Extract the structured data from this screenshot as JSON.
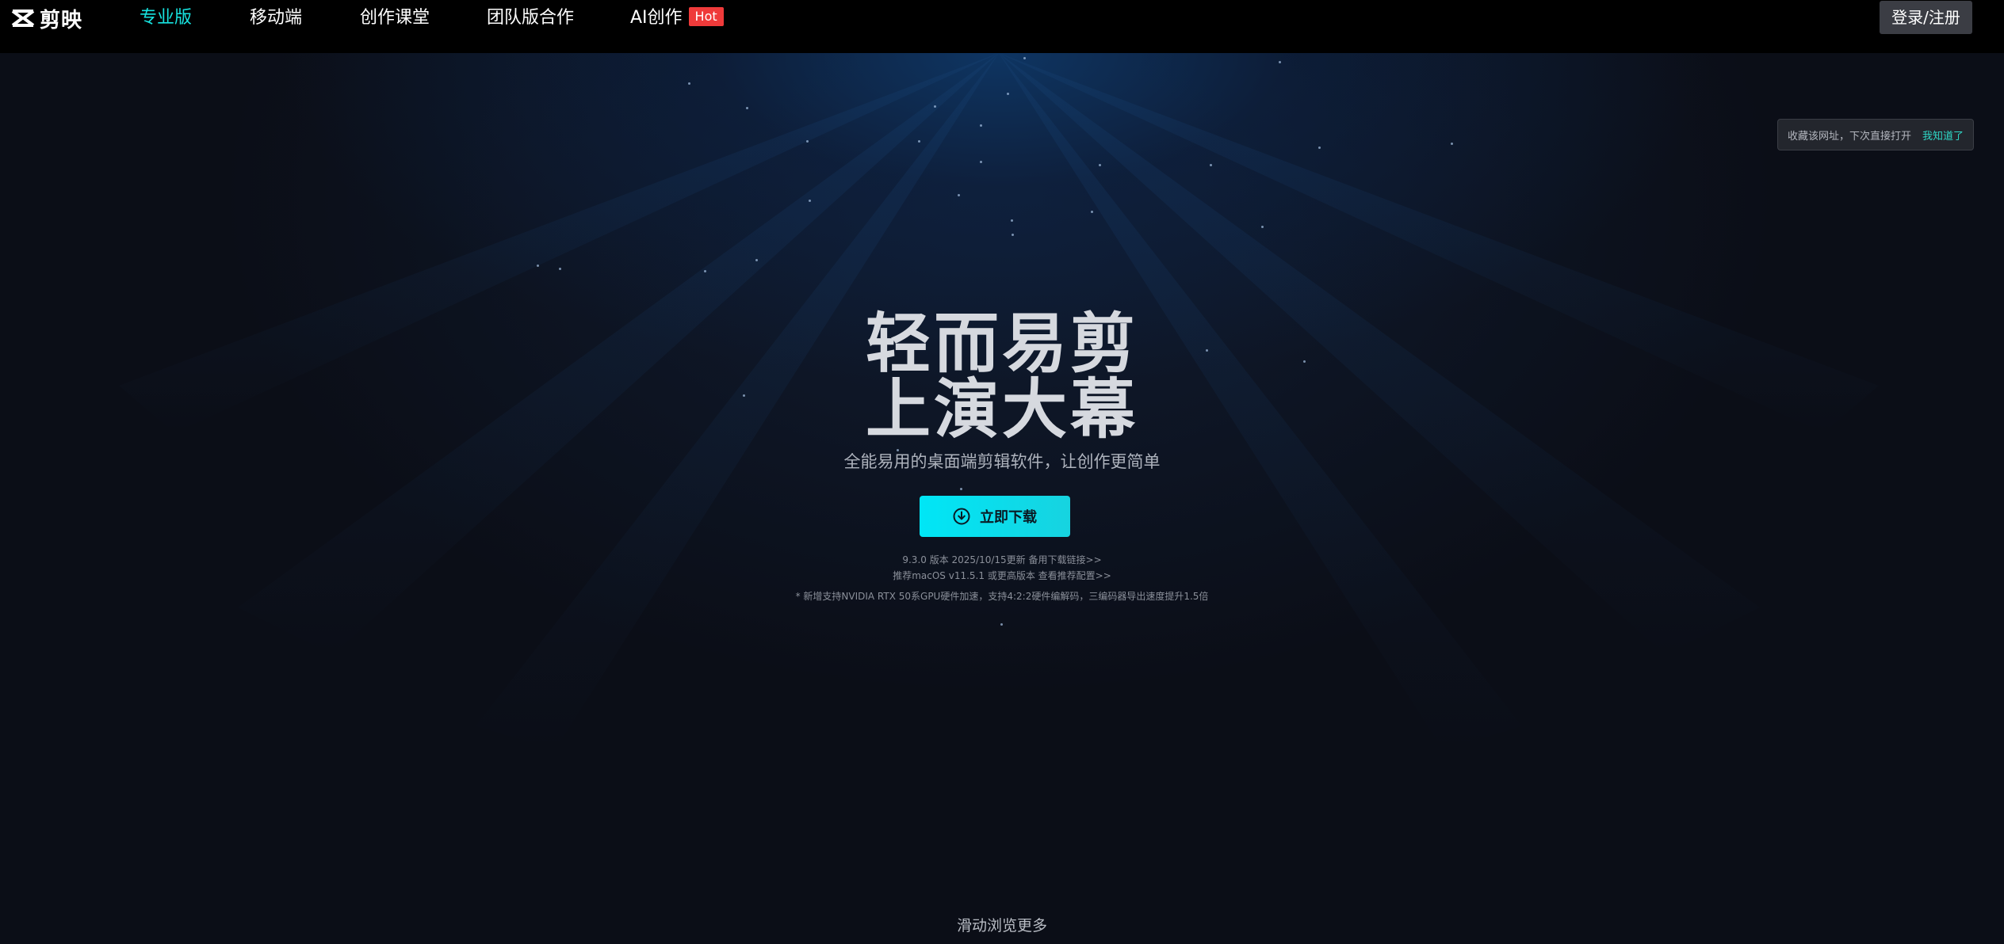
{
  "nav": {
    "logo_text": "剪映",
    "items": [
      {
        "label": "专业版"
      },
      {
        "label": "移动端"
      },
      {
        "label": "创作课堂"
      },
      {
        "label": "团队版合作"
      },
      {
        "label": "AI创作"
      }
    ],
    "hot_badge": "Hot",
    "login_label": "登录/注册"
  },
  "tooltip": {
    "text": "收藏该网址，下次直接打开",
    "button": "我知道了"
  },
  "hero": {
    "headline_1": "轻而易剪",
    "headline_2": "上演大幕",
    "subtitle": "全能易用的桌面端剪辑软件，让创作更简单",
    "download_label": "立即下载",
    "version_text": "9.3.0 版本 2025/10/15更新",
    "backup_link": "备用下载链接>>",
    "system_text": "推荐macOS v11.5.1 或更高版本",
    "config_link": "查看推荐配置>>",
    "feature_note": "* 新增支持NVIDIA RTX 50系GPU硬件加速，支持4:2:2硬件编解码，三编码器导出速度提升1.5倍",
    "scroll_hint": "滑动浏览更多"
  },
  "colors": {
    "accent": "#17e3e0",
    "hot": "#ef3a3a",
    "button_start": "#00e6f6",
    "button_end": "#17d3e0",
    "background": "#0b0e17"
  },
  "icons": [
    "capcut-logo-icon",
    "download-circle-icon"
  ]
}
